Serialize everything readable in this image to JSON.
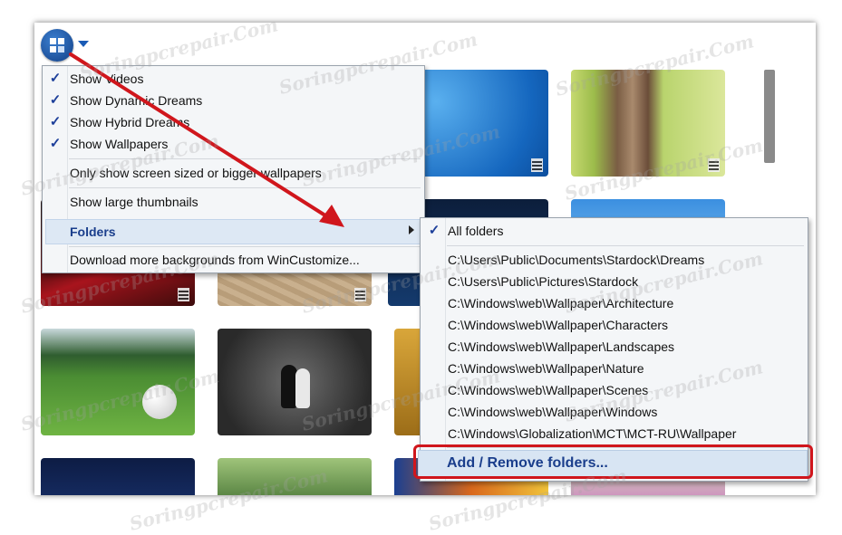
{
  "view_menu": {
    "items": [
      {
        "label": "Show Videos",
        "checked": true
      },
      {
        "label": "Show Dynamic Dreams",
        "checked": true
      },
      {
        "label": "Show Hybrid Dreams",
        "checked": true
      },
      {
        "label": "Show Wallpapers",
        "checked": true
      },
      {
        "label": "Only show screen sized or bigger wallpapers",
        "checked": false
      },
      {
        "label": "Show large thumbnails",
        "checked": false
      },
      {
        "label": "Folders",
        "checked": false,
        "submenu": true
      },
      {
        "label": "Download more backgrounds from WinCustomize...",
        "checked": false
      }
    ]
  },
  "folders_submenu": {
    "items": [
      {
        "label": "All folders",
        "checked": true
      },
      {
        "label": "C:\\Users\\Public\\Documents\\Stardock\\Dreams"
      },
      {
        "label": "C:\\Users\\Public\\Pictures\\Stardock"
      },
      {
        "label": "C:\\Windows\\web\\Wallpaper\\Architecture"
      },
      {
        "label": "C:\\Windows\\web\\Wallpaper\\Characters"
      },
      {
        "label": "C:\\Windows\\web\\Wallpaper\\Landscapes"
      },
      {
        "label": "C:\\Windows\\web\\Wallpaper\\Nature"
      },
      {
        "label": "C:\\Windows\\web\\Wallpaper\\Scenes"
      },
      {
        "label": "C:\\Windows\\web\\Wallpaper\\Windows"
      },
      {
        "label": "C:\\Windows\\Globalization\\MCT\\MCT-RU\\Wallpaper"
      }
    ],
    "add_remove": "Add / Remove folders..."
  },
  "check_glyph": "✓",
  "watermark_text": "Soringpcrepair.Com",
  "colors": {
    "accent": "#1a3e8c",
    "highlight": "#dde8f4",
    "annotation": "#d0161c",
    "check": "#1d3f9a"
  },
  "icons": [
    "app-logo-icon",
    "dropdown-caret-icon",
    "submenu-arrow-icon",
    "video-badge-icon",
    "checkmark-icon"
  ]
}
